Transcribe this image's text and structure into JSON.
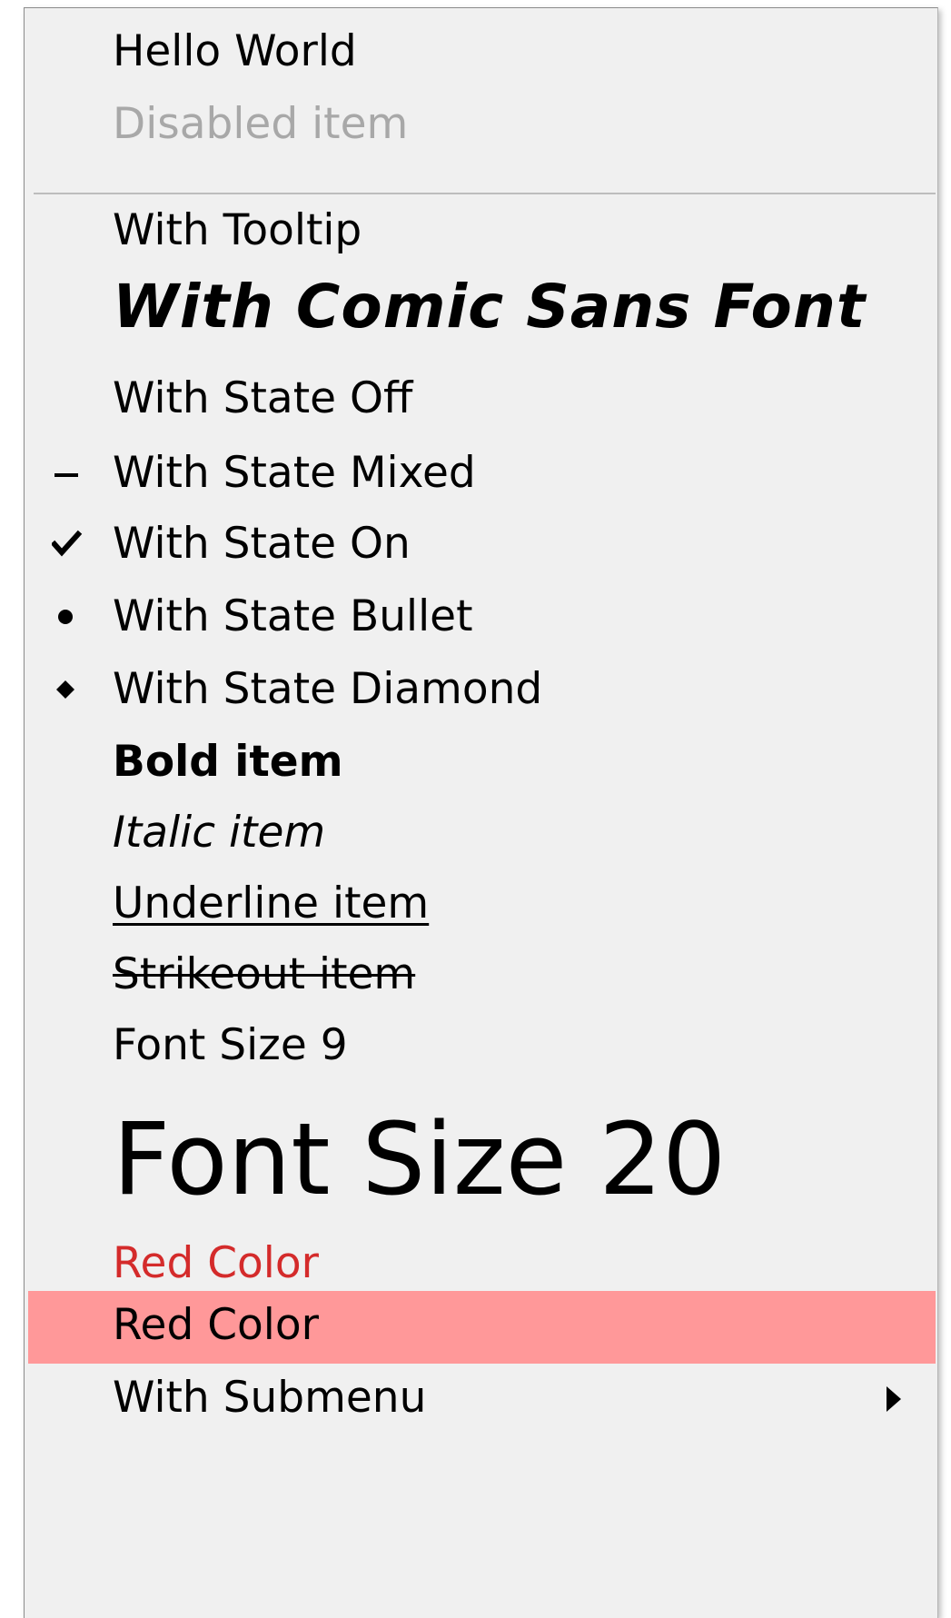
{
  "menu": {
    "items": {
      "hello": {
        "label": "Hello World"
      },
      "disabled": {
        "label": "Disabled item"
      },
      "tooltip": {
        "label": "With Tooltip"
      },
      "comic": {
        "label": "With Comic Sans Font"
      },
      "state_off": {
        "label": "With State Off"
      },
      "state_mixed": {
        "label": "With State Mixed",
        "state_icon": "dash-icon"
      },
      "state_on": {
        "label": "With State On",
        "state_icon": "checkmark-icon"
      },
      "state_bullet": {
        "label": "With State Bullet",
        "state_icon": "bullet-icon"
      },
      "state_diamond": {
        "label": "With State Diamond",
        "state_icon": "diamond-icon"
      },
      "bold": {
        "label": "Bold item"
      },
      "italic": {
        "label": "Italic item"
      },
      "underline": {
        "label": "Underline item"
      },
      "strikeout": {
        "label": "Strikeout item"
      },
      "font9": {
        "label": "Font Size 9"
      },
      "font20": {
        "label": "Font Size 20"
      },
      "red": {
        "label": "Red Color",
        "color": "#d42b2b"
      },
      "red_bg": {
        "label": "Red Color",
        "background": "#ff9899"
      },
      "submenu": {
        "label": "With Submenu",
        "icon": "submenu-arrow-icon"
      }
    }
  },
  "colors": {
    "menu_background": "#f0f0f0",
    "disabled_text": "#a8a8a8",
    "separator": "#bdbdbd"
  }
}
